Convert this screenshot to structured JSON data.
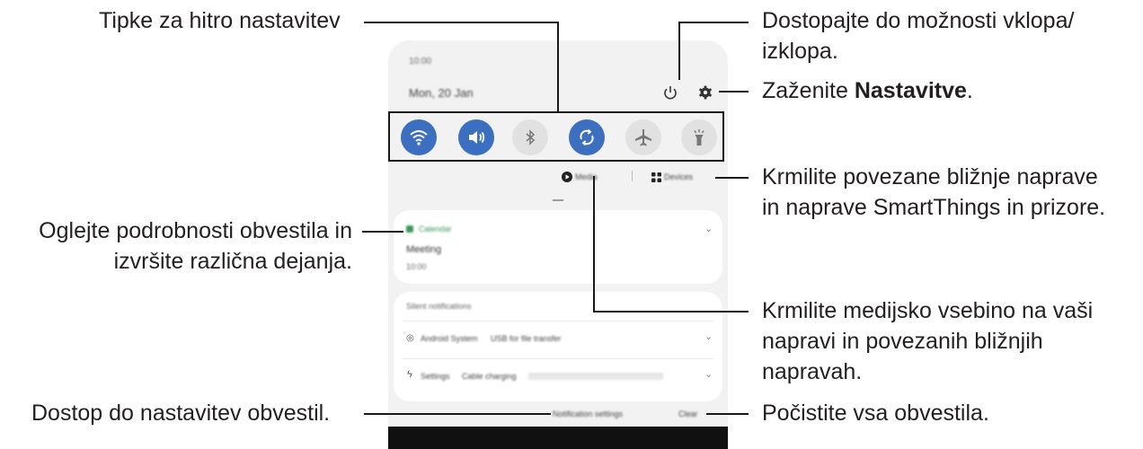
{
  "callouts": {
    "quick_settings": "Tipke za hitro nastavitev",
    "power_line1": "Dostopajte do možnosti vklopa/",
    "power_line2": "izklopa.",
    "settings_prefix": "Zaženite ",
    "settings_bold": "Nastavitve",
    "settings_suffix": ".",
    "devices_line1": "Krmilite povezane bližnje naprave",
    "devices_line2": "in naprave SmartThings in prizore.",
    "notification_line1": "Oglejte podrobnosti obvestila in",
    "notification_line2": "izvršite različna dejanja.",
    "media_line1": "Krmilite medijsko vsebino na vaši",
    "media_line2": "napravi in povezanih bližnjih",
    "media_line3": "napravah.",
    "notif_settings": "Dostop do nastavitev obvestil.",
    "clear": "Počistite vsa obvestila."
  },
  "phone": {
    "time": "10:00",
    "date": "Mon, 20 Jan",
    "quick_buttons": [
      {
        "icon": "wifi-icon",
        "active": true
      },
      {
        "icon": "sound-icon",
        "active": true
      },
      {
        "icon": "bluetooth-icon",
        "active": false
      },
      {
        "icon": "auto-rotate-icon",
        "active": true
      },
      {
        "icon": "airplane-icon",
        "active": false
      },
      {
        "icon": "flashlight-icon",
        "active": false
      }
    ],
    "media_label": "Media",
    "devices_label": "Devices",
    "notification": {
      "app": "Calendar",
      "title": "Meeting",
      "time": "10:00"
    },
    "silent_header": "Silent notifications",
    "silent_items": [
      {
        "app": "Android System",
        "text": "USB for file transfer"
      },
      {
        "app": "Settings",
        "text": "Cable charging"
      }
    ],
    "notification_settings_label": "Notification settings",
    "clear_label": "Clear"
  },
  "colors": {
    "accent": "#3d6fc1",
    "panel_bg": "#f2f2f2",
    "line": "#1a1a1a"
  }
}
